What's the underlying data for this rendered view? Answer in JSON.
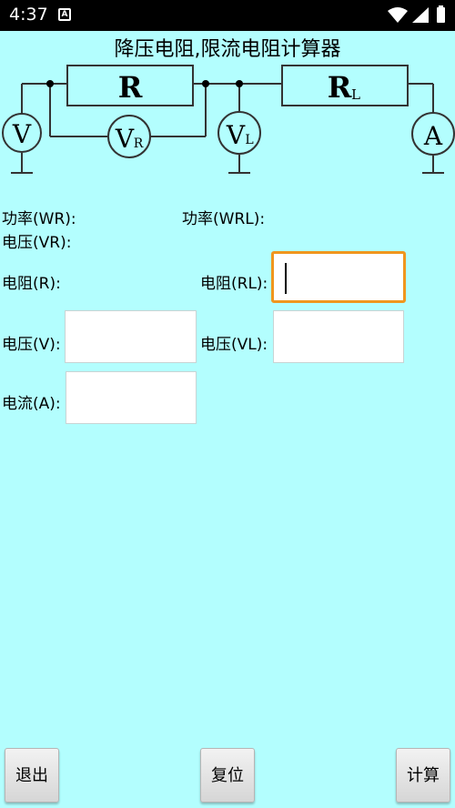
{
  "status": {
    "time": "4:37"
  },
  "app": {
    "title": "降压电阻,限流电阻计算器"
  },
  "circuit": {
    "resistor_r": "R",
    "resistor_rl_main": "R",
    "resistor_rl_sub": "L",
    "meter_v": "V",
    "meter_vr_main": "V",
    "meter_vr_sub": "R",
    "meter_vl_main": "V",
    "meter_vl_sub": "L",
    "meter_a": "A"
  },
  "labels": {
    "power_wr": "功率(WR):",
    "power_wrl": "功率(WRL):",
    "voltage_vr": "电压(VR):",
    "resistance_r": "电阻(R):",
    "resistance_rl": "电阻(RL):",
    "voltage_v": "电压(V):",
    "voltage_vl": "电压(VL):",
    "current_a": "电流(A):"
  },
  "inputs": {
    "resistance_rl": "",
    "voltage_v": "",
    "voltage_vl": "",
    "current_a": ""
  },
  "buttons": {
    "exit": "退出",
    "reset": "复位",
    "calculate": "计算"
  },
  "colors": {
    "background": "#b3fefe",
    "focus": "#f0961e"
  }
}
